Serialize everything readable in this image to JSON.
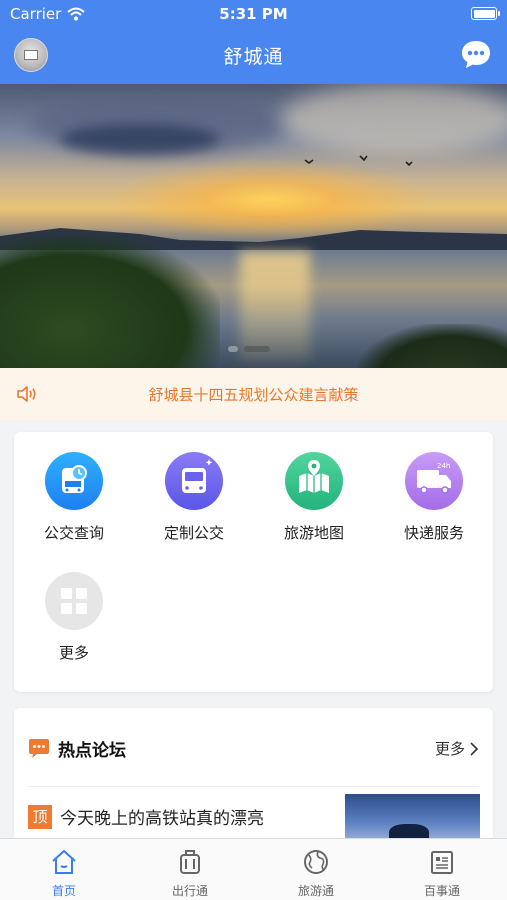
{
  "status_bar": {
    "carrier": "Carrier",
    "time": "5:31 PM"
  },
  "header": {
    "title": "舒城通"
  },
  "banner": {
    "slides": 2,
    "active_slide": 2
  },
  "notice": {
    "text": "舒城县十四五规划公众建言献策"
  },
  "services": [
    {
      "label": "公交查询",
      "icon": "bus-clock-icon"
    },
    {
      "label": "定制公交",
      "icon": "custom-bus-icon"
    },
    {
      "label": "旅游地图",
      "icon": "travel-map-icon"
    },
    {
      "label": "快递服务",
      "icon": "delivery-truck-icon"
    },
    {
      "label": "更多",
      "icon": "grid-more-icon"
    }
  ],
  "forum": {
    "title": "热点论坛",
    "more_label": "更多",
    "items": [
      {
        "tag": "顶",
        "title": "今天晚上的高铁站真的漂亮"
      }
    ]
  },
  "tabbar": {
    "items": [
      {
        "label": "首页",
        "icon": "home-icon",
        "active": true
      },
      {
        "label": "出行通",
        "icon": "luggage-icon",
        "active": false
      },
      {
        "label": "旅游通",
        "icon": "globe-icon",
        "active": false
      },
      {
        "label": "百事通",
        "icon": "news-icon",
        "active": false
      }
    ]
  },
  "colors": {
    "accent": "#4a86f0",
    "notice_text": "#e8772e",
    "tab_active": "#3b7cf2"
  }
}
